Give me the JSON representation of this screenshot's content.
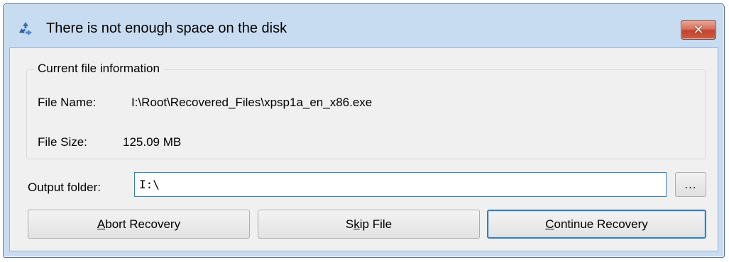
{
  "window": {
    "title": "There is not enough space on the disk",
    "close_glyph": "✕",
    "icon": "recycle-icon"
  },
  "file_info": {
    "group_title": "Current file information",
    "name_label": "File Name:",
    "name_value": "I:\\Root\\Recovered_Files\\xpsp1a_en_x86.exe",
    "size_label": "File Size:",
    "size_value": "125.09 MB"
  },
  "output": {
    "label": "Output folder:",
    "value": "I:\\",
    "browse_label": "..."
  },
  "buttons": {
    "abort": {
      "mnemonic": "A",
      "rest": "bort Recovery"
    },
    "skip": {
      "pre": "S",
      "mnemonic": "k",
      "rest": "ip File"
    },
    "continue": {
      "mnemonic": "C",
      "rest": "ontinue Recovery"
    }
  },
  "colors": {
    "accent": "#3c7fb1",
    "window_frame": "#c8dcf1",
    "dialog_bg": "#f0f0f0",
    "close_red": "#c2442e"
  }
}
